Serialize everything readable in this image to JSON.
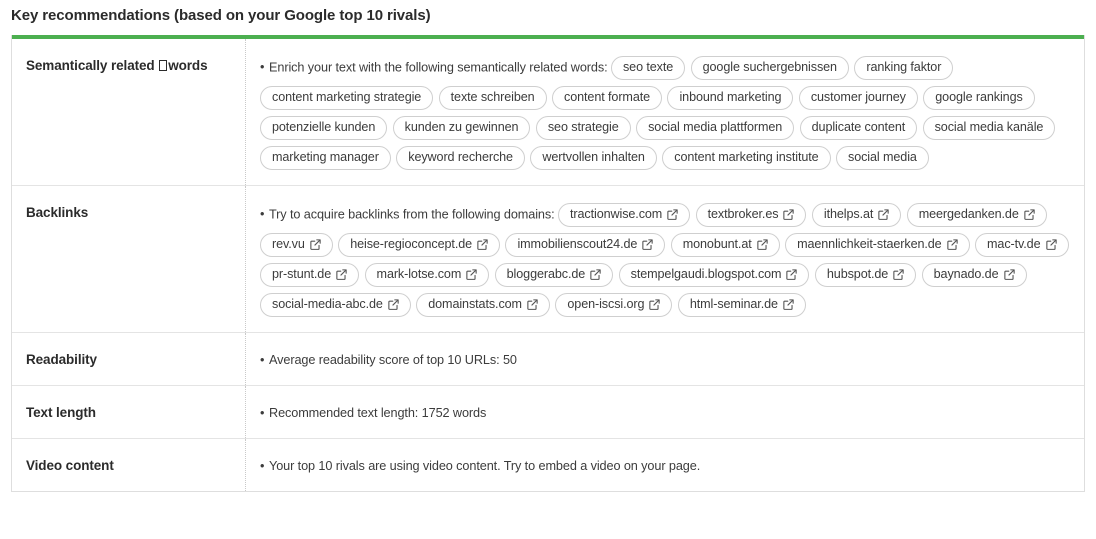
{
  "panel": {
    "title": "Key recommendations (based on your Google top 10 rivals)",
    "accent_color": "#4caf50",
    "border_color": "#dedede"
  },
  "rows": [
    {
      "label_prefix": "Semantically related ",
      "label_suffix": "words",
      "label_has_missing_glyph": true,
      "lead": "Enrich your text with the following semantically related words:",
      "type": "keywords",
      "pills": [
        "seo texte",
        "google suchergebnissen",
        "ranking faktor",
        "content marketing strategie",
        "texte schreiben",
        "content formate",
        "inbound marketing",
        "customer journey",
        "google rankings",
        "potenzielle kunden",
        "kunden zu gewinnen",
        "seo strategie",
        "social media plattformen",
        "duplicate content",
        "social media kanäle",
        "marketing manager",
        "keyword recherche",
        "wertvollen inhalten",
        "content marketing institute",
        "social media"
      ]
    },
    {
      "label_prefix": "Backlinks",
      "label_suffix": "",
      "label_has_missing_glyph": false,
      "lead": "Try to acquire backlinks from the following domains:",
      "type": "links",
      "pills": [
        "tractionwise.com",
        "textbroker.es",
        "ithelps.at",
        "meergedanken.de",
        "rev.vu",
        "heise-regioconcept.de",
        "immobilienscout24.de",
        "monobunt.at",
        "maennlichkeit-staerken.de",
        "mac-tv.de",
        "pr-stunt.de",
        "mark-lotse.com",
        "bloggerabc.de",
        "stempelgaudi.blogspot.com",
        "hubspot.de",
        "baynado.de",
        "social-media-abc.de",
        "domainstats.com",
        "open-iscsi.org",
        "html-seminar.de"
      ]
    },
    {
      "label_prefix": "Readability",
      "label_suffix": "",
      "label_has_missing_glyph": false,
      "lead": "Average readability score of top 10 URLs:  50",
      "type": "text",
      "pills": []
    },
    {
      "label_prefix": "Text length",
      "label_suffix": "",
      "label_has_missing_glyph": false,
      "lead": "Recommended text length:  1752 words",
      "type": "text",
      "pills": []
    },
    {
      "label_prefix": "Video content",
      "label_suffix": "",
      "label_has_missing_glyph": false,
      "lead": "Your top 10 rivals are using video content. Try to embed a video on your page.",
      "type": "text",
      "pills": []
    }
  ]
}
